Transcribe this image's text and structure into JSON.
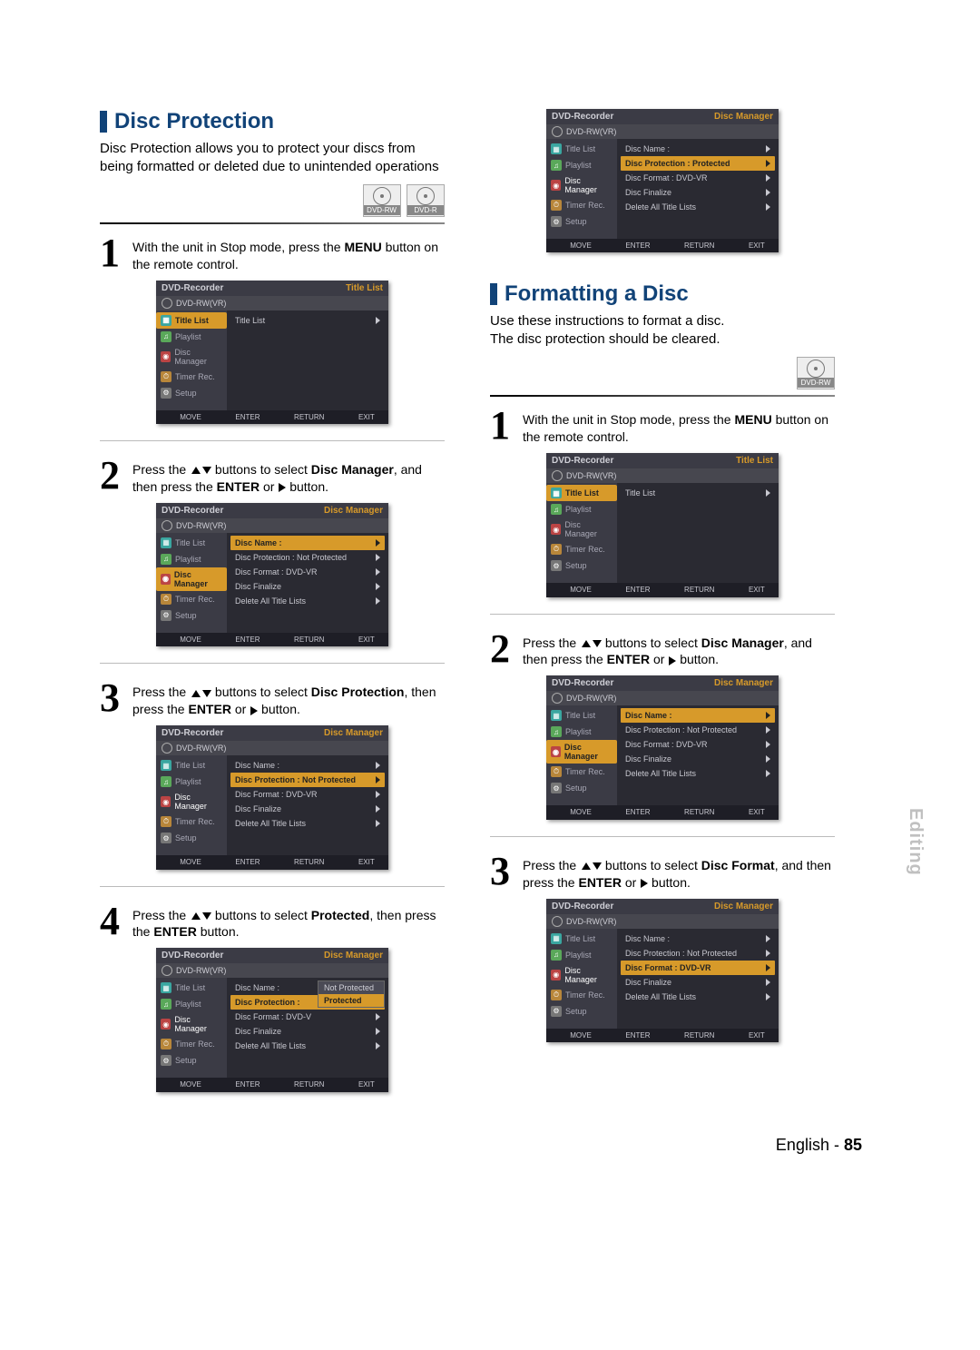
{
  "leftColumn": {
    "title": "Disc Protection",
    "intro": "Disc Protection allows you to protect your discs from being formatted or deleted due to unintended operations",
    "discIcons": [
      "DVD-RW",
      "DVD-R"
    ],
    "step1": {
      "num": "1",
      "textA": "With the unit in Stop mode, press the ",
      "textB": "MENU",
      "textC": " button on the remote control."
    },
    "step2": {
      "num": "2",
      "pre": "Press the ",
      "mid": " buttons to select ",
      "target": "Disc Manager",
      "after": ", and then press the ",
      "enter": "ENTER",
      "or": " or ",
      "btnEnd": " button."
    },
    "step3": {
      "num": "3",
      "pre": "Press the ",
      "mid": " buttons to select ",
      "target": "Disc Protection",
      "after": ", then press the ",
      "enter": "ENTER",
      "or": " or ",
      "btnEnd": " button."
    },
    "step4": {
      "num": "4",
      "pre": "Press the ",
      "mid": " buttons to select ",
      "target": "Protected",
      "after": ", then press the ",
      "enter": "ENTER",
      "btnEnd": " button."
    }
  },
  "rightColumn": {
    "title": "Formatting a Disc",
    "intro": "Use these instructions to format a disc.\nThe disc protection should be cleared.",
    "discIcons": [
      "DVD-RW"
    ],
    "step1": {
      "num": "1",
      "textA": "With the unit in Stop mode, press the ",
      "textB": "MENU",
      "textC": " button on the remote control."
    },
    "step2": {
      "num": "2",
      "pre": "Press the ",
      "mid": " buttons to select ",
      "target": "Disc Manager",
      "after": ", and then press the ",
      "enter": "ENTER",
      "or": " or ",
      "btnEnd": " button."
    },
    "step3": {
      "num": "3",
      "pre": "Press the ",
      "mid": " buttons to select ",
      "target": "Disc Format",
      "after": ", and then press the ",
      "enter": "ENTER",
      "or": " or ",
      "btnEnd": " button."
    }
  },
  "osd": {
    "recorder": "DVD-Recorder",
    "titleList": "Title List",
    "discManager": "Disc Manager",
    "sub": "DVD-RW(VR)",
    "side": {
      "titleList": "Title List",
      "playlist": "Playlist",
      "discManager": "Disc Manager",
      "timerRec": "Timer Rec.",
      "setup": "Setup"
    },
    "rows": {
      "titleList": "Title List",
      "discName": "Disc Name :",
      "protectionNot": "Disc Protection : Not Protected",
      "protectionYes": "Disc Protection : Protected",
      "protectionLabel": "Disc Protection :",
      "formatVR": "Disc Format : DVD-VR",
      "formatV": "Disc Format : DVD-V",
      "finalize": "Disc Finalize",
      "deleteAll": "Delete All Title Lists"
    },
    "popup": {
      "opt1": "Not Protected",
      "opt2": "Protected"
    },
    "footer": {
      "move": "MOVE",
      "enter": "ENTER",
      "return": "RETURN",
      "exit": "EXIT"
    }
  },
  "sideLabel": "Editing",
  "footer": {
    "lang": "English",
    "sep": " - ",
    "page": "85"
  }
}
